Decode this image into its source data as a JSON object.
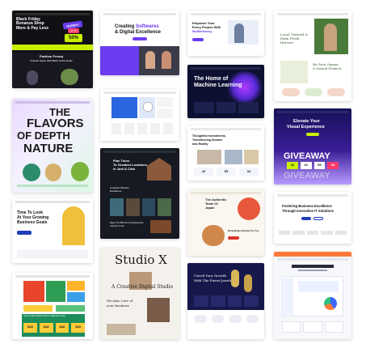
{
  "colors": {
    "accent_yellow": "#c8f000",
    "purple": "#6b3df0",
    "dark_navy": "#0d1030",
    "teal": "#1b6b8a",
    "green": "#4a7a3a"
  },
  "cards": {
    "c1": {
      "title": "Black Friday Bonanza Shop More & Pay Less",
      "badge_1": "HURRY!",
      "badge_2": "UP TO",
      "badge_3": "50%",
      "promo": "Fashion Frenzy",
      "promo_sub": "Unleash Styles With Black Friday Deals"
    },
    "c2": {
      "title_1": "Creating",
      "title_accent": "Softwares",
      "title_2": "& Digital Excellence"
    },
    "c3": {
      "title_1": "Empower Your",
      "title_2": "Every Project With",
      "title_3": "Multitenancy"
    },
    "c4": {
      "title_1": "Local, Natural &",
      "title_2": "Farm Fresh",
      "title_3": "Harvest",
      "sub_1": "We Grow Organic",
      "sub_2": "& Natural Products"
    },
    "c5": {
      "title_1": "THE",
      "title_2": "FLAVORS",
      "title_3": "OF DEPTH",
      "title_4": "NATURE"
    },
    "c7": {
      "title_1": "The Home of",
      "title_2": "Machine Learning"
    },
    "c8": {
      "title_1": "Elevate Your",
      "title_2": "Visual Experience",
      "giveaway": "GIVEAWAY",
      "timer": [
        "42",
        "16",
        "55",
        "34"
      ]
    },
    "c9": {
      "title_1": "Thoughtful Investments,",
      "title_2": "Transforming Dreams",
      "title_3": "Into Reality",
      "stats": [
        "42",
        "55",
        "34"
      ]
    },
    "c10": {
      "title_1": "Plan Tours",
      "title_2": "To Greatest Locations",
      "title_3": "In Just A Click",
      "section_1": "Unspoken Bucket",
      "section_2": "Excellence",
      "section_3": "Enjoy The With Our Comprehensive",
      "section_4": "Journey To Life"
    },
    "c11": {
      "title_1": "Time To Look",
      "title_2": "At Your Growing",
      "title_3": "Business Goals"
    },
    "c12": {
      "title_1": "The Authentic",
      "title_2": "Taste Of",
      "title_3": "Japan",
      "sub": "Bring Nobles Recipe For You"
    },
    "c13": {
      "title_1": "Fostering Business Excellence",
      "title_2": "Through Innovative IT Solutions"
    },
    "c14": {
      "title_1": "Studio X",
      "title_2": "A Creative Digital Studio",
      "sub_1": "We take Care of",
      "sub_2": "your business"
    },
    "c15": {
      "title_1": "Unveil Your Growth",
      "title_2": "With The Finest Jewelry"
    },
    "c16": {
      "title": "Get The Best Mobile Phone Collection Prices",
      "prices": [
        "$28",
        "$18",
        "$28",
        "$20"
      ]
    }
  }
}
